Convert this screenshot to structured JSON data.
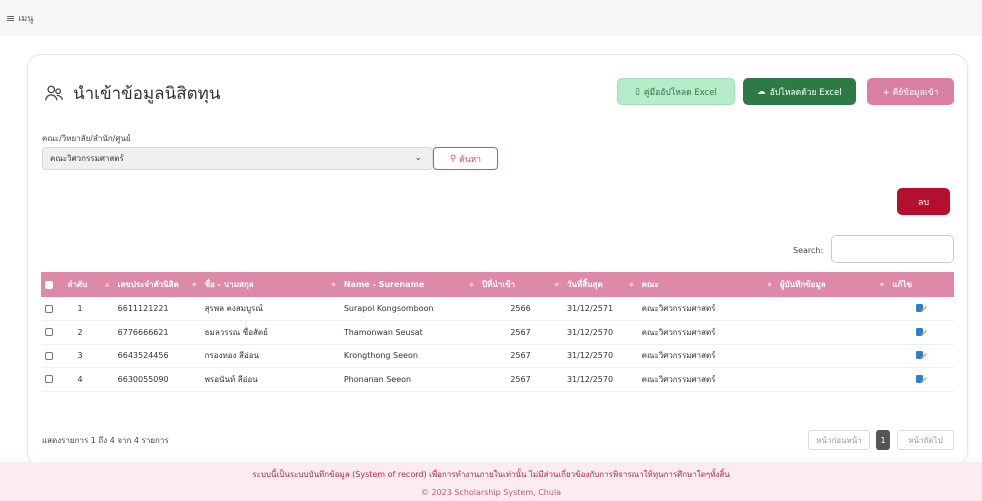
{
  "topbar": {
    "menu_icon": "hamburger-icon",
    "menu_label": "เมนู"
  },
  "page": {
    "title": "นำเข้าข้อมูลนิสิตทุน",
    "title_icon": "users-icon"
  },
  "buttons": {
    "manual": "คู่มืออัปโหลด Excel",
    "upload": "อัปโหลดด้วย Excel",
    "add": "+ คีย์ข้อมูลเข้า",
    "search": "ค้นหา",
    "delete": "ลบ"
  },
  "filter": {
    "label": "คณะ/วิทยาลัย/สำนัก/ศูนย์",
    "selected": "คณะวิศวกรรมศาสตร์"
  },
  "table_search": {
    "label": "Search:",
    "value": ""
  },
  "table": {
    "headers": [
      "",
      "ลำดับ",
      "เลขประจำตัวนิสิต",
      "ชื่อ - นามสกุล",
      "Name - Surename",
      "ปีที่นำเข้า",
      "วันที่สิ้นสุด",
      "คณะ",
      "ผู้บันทึกข้อมูล",
      "แก้ไข"
    ],
    "rows": [
      {
        "no": "1",
        "id": "6611121221",
        "name_th": "สุรพล คงสมบูรณ์",
        "name_en": "Surapol Kongsomboon",
        "year": "2566",
        "end": "31/12/2571",
        "faculty": "คณะวิศวกรรมศาสตร์",
        "recorder": ""
      },
      {
        "no": "2",
        "id": "6776666621",
        "name_th": "ธมลวรรณ ซื่อสัตย์",
        "name_en": "Thamonwan Seusat",
        "year": "2567",
        "end": "31/12/2570",
        "faculty": "คณะวิศวกรรมศาสตร์",
        "recorder": ""
      },
      {
        "no": "3",
        "id": "6643524456",
        "name_th": "กรองทอง สีอ่อน",
        "name_en": "Krongthong Seeon",
        "year": "2567",
        "end": "31/12/2570",
        "faculty": "คณะวิศวกรรมศาสตร์",
        "recorder": ""
      },
      {
        "no": "4",
        "id": "6630055090",
        "name_th": "พรอนันท์ สีอ่อน",
        "name_en": "Phonanan Seeon",
        "year": "2567",
        "end": "31/12/2570",
        "faculty": "คณะวิศวกรรมศาสตร์",
        "recorder": ""
      }
    ]
  },
  "table_info": "แสดงรายการ 1 ถึง 4 จาก 4 รายการ",
  "pagination": {
    "prev": "หน้าก่อนหน้า",
    "current": "1",
    "next": "หน้าถัดไป"
  },
  "footer": {
    "line1": "ระบบนี้เป็นระบบบันทึกข้อมูล (System of record) เพื่อการทำงานภายในเท่านั้น ไม่มีส่วนเกี่ยวข้องกับการพิจารณาให้ทุนการศึกษาใดๆทั้งสิ้น",
    "line2": "© 2023 Scholarship System, Chula"
  },
  "colors": {
    "accent": "#dd8aa8",
    "danger": "#b50f2f",
    "green": "#2e7a45"
  }
}
